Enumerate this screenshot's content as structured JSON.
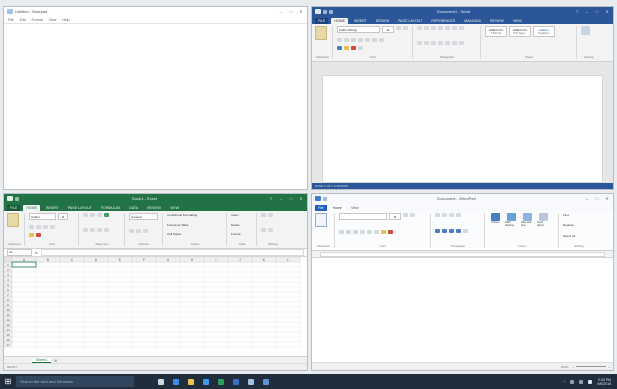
{
  "notepad": {
    "title": "Untitled - Notepad",
    "menu": [
      "File",
      "Edit",
      "Format",
      "View",
      "Help"
    ]
  },
  "word": {
    "title": "Document1 - Word",
    "tabs": [
      "FILE",
      "HOME",
      "INSERT",
      "DESIGN",
      "PAGE LAYOUT",
      "REFERENCES",
      "MAILINGS",
      "REVIEW",
      "VIEW"
    ],
    "font_name": "Calibri (Body)",
    "font_size": "11",
    "groups": [
      "Clipboard",
      "Font",
      "Paragraph",
      "Styles",
      "Editing"
    ],
    "styles": [
      "AaBbCcDc",
      "AaBbCcDc",
      "AaBbCc"
    ],
    "style_names": [
      "¶ Normal",
      "¶ No Spac...",
      "Heading 1"
    ],
    "status": "PAGE 1 OF 1   0 WORDS"
  },
  "excel": {
    "title": "Book1 - Excel",
    "tabs": [
      "FILE",
      "HOME",
      "INSERT",
      "PAGE LAYOUT",
      "FORMULAS",
      "DATA",
      "REVIEW",
      "VIEW"
    ],
    "font_name": "Calibri",
    "font_size": "11",
    "number_format": "General",
    "groups": [
      "Clipboard",
      "Font",
      "Alignment",
      "Number",
      "Styles",
      "Cells",
      "Editing"
    ],
    "style_items": [
      "Conditional Formatting",
      "Format as Table",
      "Cell Styles"
    ],
    "cell_items": [
      "Insert",
      "Delete",
      "Format"
    ],
    "name_box": "A1",
    "fx": "fx",
    "columns": [
      "A",
      "B",
      "C",
      "D",
      "E",
      "F",
      "G",
      "H",
      "I",
      "J",
      "K",
      "L"
    ],
    "rows": [
      "1",
      "2",
      "3",
      "4",
      "5",
      "6",
      "7",
      "8",
      "9",
      "10",
      "11",
      "12",
      "13",
      "14",
      "15",
      "16",
      "17"
    ],
    "sheet_tab": "Sheet1",
    "status": "READY"
  },
  "wordpad": {
    "title": "Document - WordPad",
    "tabs": [
      "File",
      "Home",
      "View"
    ],
    "font_size": "11",
    "group_labels": [
      "Clipboard",
      "Font",
      "Paragraph",
      "Insert",
      "Editing"
    ],
    "insert_items": [
      "Picture",
      "Paint drawing",
      "Date and time",
      "Insert object"
    ],
    "editing_items": [
      "Find",
      "Replace",
      "Select all"
    ],
    "zoom": "100%"
  },
  "taskbar": {
    "search_placeholder": "Search the web and Windows",
    "time": "2:43 PM",
    "date": "9/5/2015"
  }
}
